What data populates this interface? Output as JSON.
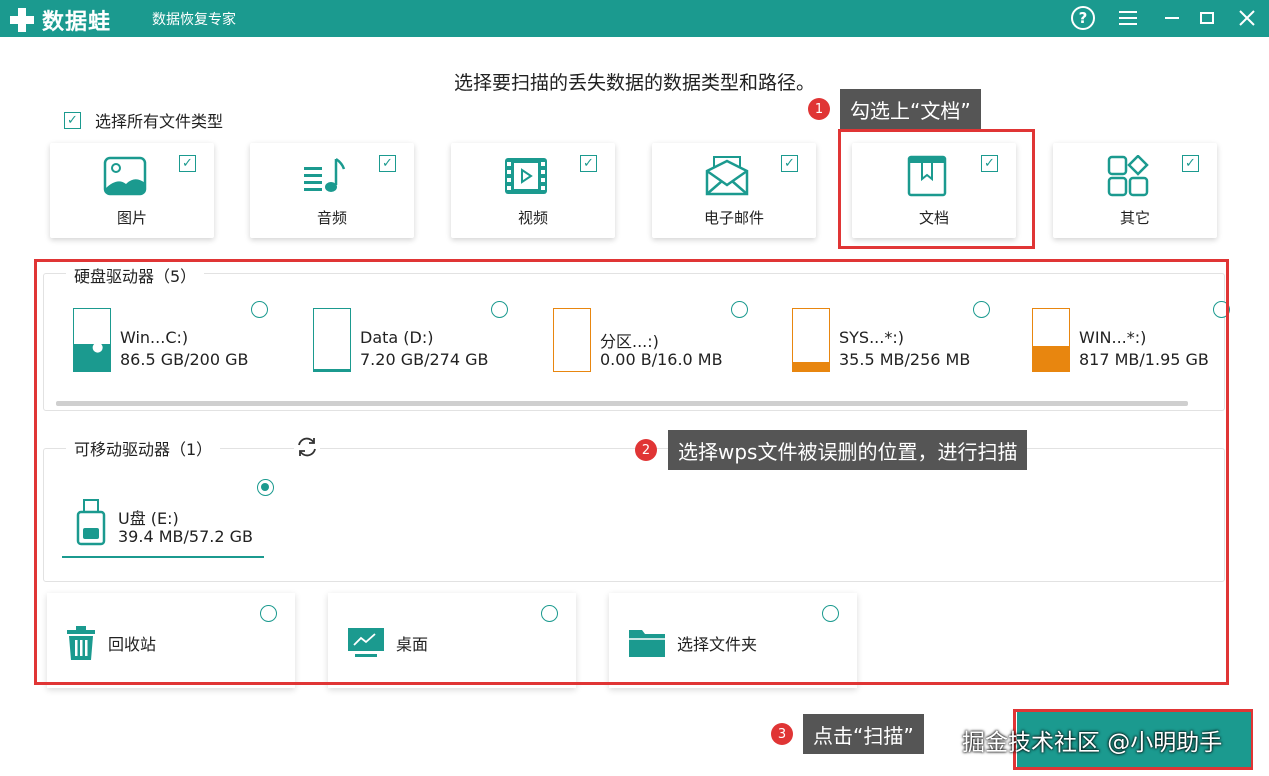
{
  "app": {
    "name": "数据蛙",
    "subtitle": "数据恢复专家",
    "help_icon": "?"
  },
  "colors": {
    "accent": "#1b9a8f",
    "annotation": "#e03535",
    "callout_bg": "#555555",
    "partition_orange": "#e8860f"
  },
  "heading": "选择要扫描的丢失数据的数据类型和路径。",
  "select_all": {
    "label": "选择所有文件类型",
    "checked": true
  },
  "file_types": [
    {
      "label": "图片",
      "icon": "image-icon",
      "checked": true
    },
    {
      "label": "音频",
      "icon": "audio-icon",
      "checked": true
    },
    {
      "label": "视频",
      "icon": "video-icon",
      "checked": true
    },
    {
      "label": "电子邮件",
      "icon": "email-icon",
      "checked": true
    },
    {
      "label": "文档",
      "icon": "document-icon",
      "checked": true
    },
    {
      "label": "其它",
      "icon": "other-icon",
      "checked": true
    }
  ],
  "hard_drives": {
    "title": "硬盘驱动器（5）",
    "items": [
      {
        "name": "Win...C:)",
        "size": "86.5 GB/200 GB",
        "used_fraction": 0.43
      },
      {
        "name": "Data (D:)",
        "size": "7.20 GB/274 GB",
        "used_fraction": 0.03
      },
      {
        "name": "分区...:)",
        "size": "0.00  B/16.0 MB",
        "used_fraction": 0.0
      },
      {
        "name": "SYS...*:)",
        "size": "35.5 MB/256 MB",
        "used_fraction": 0.14
      },
      {
        "name": "WIN...*:)",
        "size": "817 MB/1.95 GB",
        "used_fraction": 0.41
      }
    ]
  },
  "removable": {
    "title": "可移动驱动器（1）",
    "items": [
      {
        "name": "U盘 (E:)",
        "size": "39.4 MB/57.2 GB",
        "selected": true
      }
    ]
  },
  "locations": [
    {
      "label": "回收站",
      "icon": "recycle-bin-icon"
    },
    {
      "label": "桌面",
      "icon": "desktop-icon"
    },
    {
      "label": "选择文件夹",
      "icon": "folder-icon"
    }
  ],
  "callouts": [
    {
      "num": "1",
      "text": "勾选上“文档”"
    },
    {
      "num": "2",
      "text": "选择wps文件被误删的位置，进行扫描"
    },
    {
      "num": "3",
      "text": "点击“扫描”"
    }
  ],
  "watermark": "掘金技术社区 @小明助手"
}
